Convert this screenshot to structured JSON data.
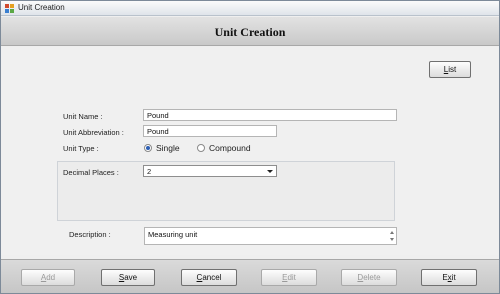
{
  "window": {
    "title": "Unit Creation"
  },
  "header": {
    "title": "Unit Creation"
  },
  "toolbar": {
    "list_prefix": "",
    "list_hot": "L",
    "list_rest": "ist"
  },
  "form": {
    "unit_name_label": "Unit Name :",
    "unit_name_value": "Pound",
    "unit_abbr_label": "Unit Abbreviation :",
    "unit_abbr_value": "Pound",
    "unit_type_label": "Unit Type :",
    "unit_type_options": [
      "Single",
      "Compound"
    ],
    "unit_type_selected": "Single",
    "decimal_places_label": "Decimal Places :",
    "decimal_places_value": "2",
    "description_label": "Description :",
    "description_value": "Measuring unit"
  },
  "footer": {
    "add": {
      "hot": "A",
      "rest": "dd",
      "enabled": false
    },
    "save": {
      "hot": "S",
      "rest": "ave",
      "enabled": true
    },
    "cancel": {
      "hot": "C",
      "rest": "ancel",
      "enabled": true
    },
    "edit": {
      "hot": "E",
      "rest": "dit",
      "enabled": false
    },
    "delete": {
      "hot": "D",
      "rest": "elete",
      "enabled": false
    },
    "exit": {
      "hot": "x",
      "prefix": "E",
      "rest": "it",
      "enabled": true
    }
  },
  "icons": {
    "app": "app-icon",
    "radio": "radio-icon",
    "dropdown": "chevron-down-icon"
  }
}
